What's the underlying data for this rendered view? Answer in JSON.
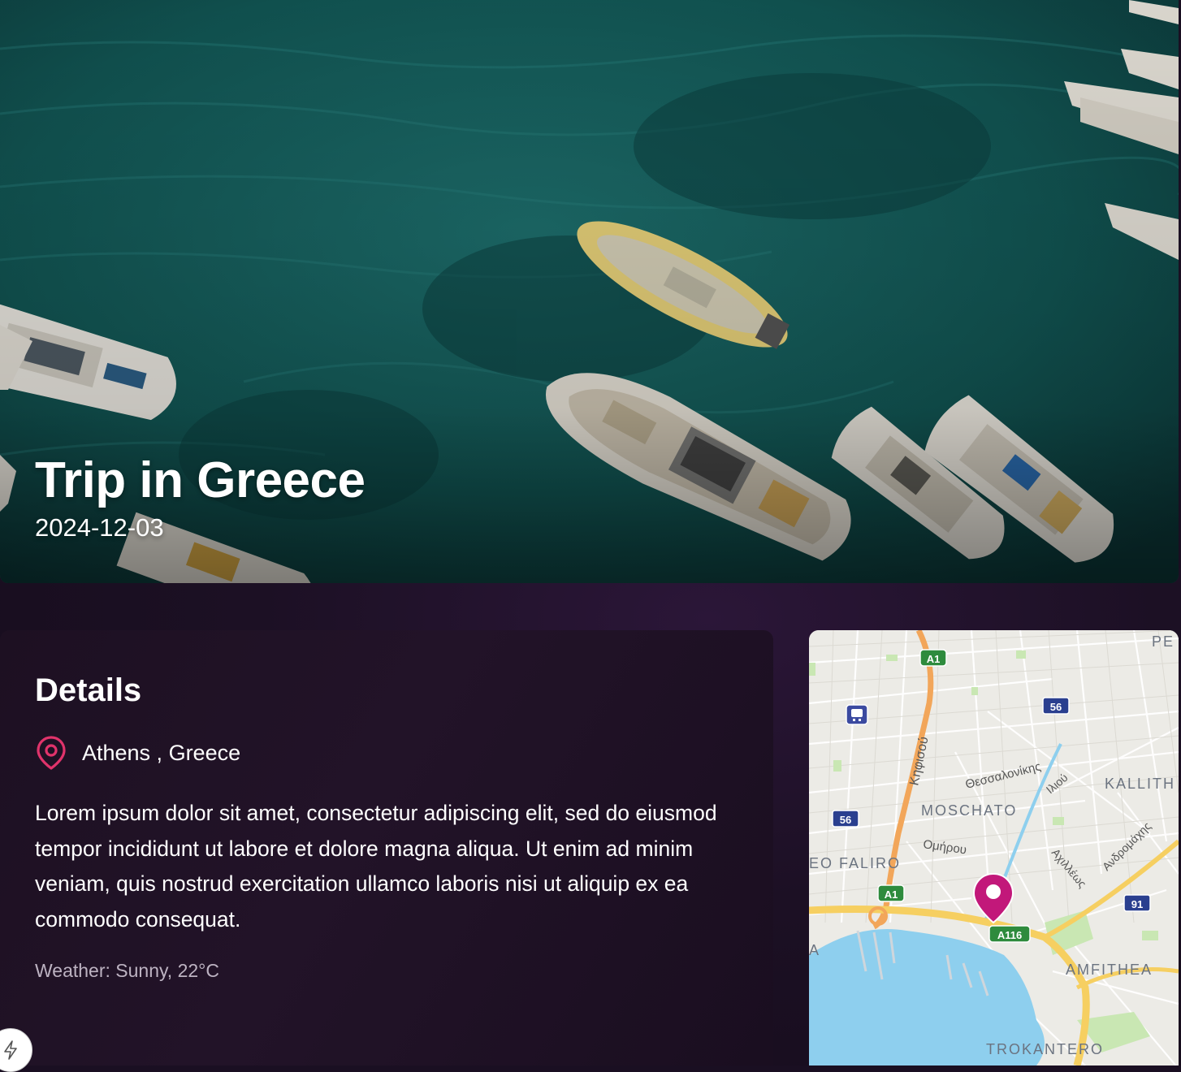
{
  "hero": {
    "title": "Trip in Greece",
    "date": "2024-12-03"
  },
  "details": {
    "heading": "Details",
    "location": "Athens , Greece",
    "description": "Lorem ipsum dolor sit amet, consectetur adipiscing elit, sed do eiusmod tempor incididunt ut labore et dolore magna aliqua. Ut enim ad minim veniam, quis nostrud exercitation ullamco laboris nisi ut aliquip ex ea commodo consequat.",
    "weather": "Weather: Sunny, 22°C"
  },
  "map": {
    "labels": {
      "a1_top": "A1",
      "a1_bottom": "A1",
      "r56_right": "56",
      "r56_left": "56",
      "r91": "91",
      "a116": "A116",
      "kifisou": "Κηφισού",
      "thessalonikis": "Θεσσαλονίκης",
      "iliou": "Ιλιού",
      "kallith": "KALLITH",
      "moschato": "MOSCHATO",
      "omirou": "Ομήρου",
      "andromachis": "Ανδρομάχης",
      "faliro": "EO FALIRO",
      "achilleos": "Αχιλλέως",
      "amfithea": "AMFITHEA",
      "trokantero": "TROKANTERO",
      "pe": "PE",
      "a_left": "A"
    },
    "pin_color": "#c2187a"
  },
  "icons": {
    "location_pin": "map-pin-icon",
    "fab": "lightning-icon"
  },
  "colors": {
    "accent_pin": "#e0336b",
    "background": "#1a0f22"
  }
}
